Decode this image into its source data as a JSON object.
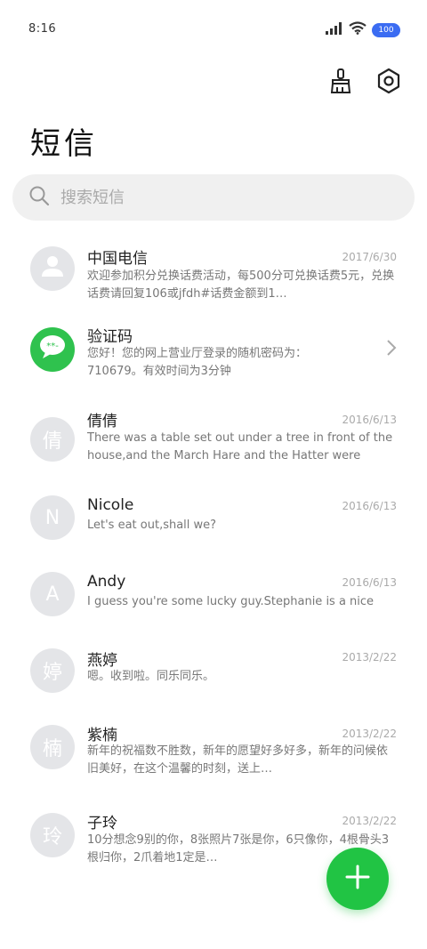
{
  "status_bar": {
    "time": "8:16",
    "battery": "100"
  },
  "header": {
    "title": "短信"
  },
  "search": {
    "placeholder": "搜索短信"
  },
  "colors": {
    "accent": "#21c444",
    "avatar_gray": "#e4e5e8",
    "battery_blue": "#3b6cf2"
  },
  "messages": [
    {
      "name": "中国电信",
      "date": "2017/6/30",
      "avatar": "",
      "avatar_icon": "person-icon",
      "preview": "欢迎参加积分兑换话费活动，每500分可兑换话费5元，兑换话费请回复106或jfdh#话费金额到1…"
    },
    {
      "name": "验证码",
      "date": "",
      "avatar": "",
      "avatar_icon": "chat-bubble-icon",
      "preview": "您好！您的网上营业厅登录的随机密码为：710679。有效时间为3分钟"
    },
    {
      "name": "倩倩",
      "date": "2016/6/13",
      "avatar": "倩",
      "preview": "There was a table set out under a tree in front of the house,and the March Hare and the Hatter were having …"
    },
    {
      "name": "Nicole",
      "date": "2016/6/13",
      "avatar": "N",
      "preview": "Let's eat out,shall we?"
    },
    {
      "name": "Andy",
      "date": "2016/6/13",
      "avatar": "A",
      "preview": "I guess you're some lucky guy.Stephanie is a nice girl."
    },
    {
      "name": "燕婷",
      "date": "2013/2/22",
      "avatar": "婷",
      "preview": "嗯。收到啦。同乐同乐。"
    },
    {
      "name": "紫楠",
      "date": "2013/2/22",
      "avatar": "楠",
      "preview": "新年的祝福数不胜数，新年的愿望好多好多，新年的问候依旧美好，在这个温馨的时刻，送上…"
    },
    {
      "name": "子玲",
      "date": "2013/2/22",
      "avatar": "玲",
      "preview": "10分想念9别的你，8张照片7张是你，6只像你，4根骨头3根归你，2爪着地1定是…"
    }
  ]
}
